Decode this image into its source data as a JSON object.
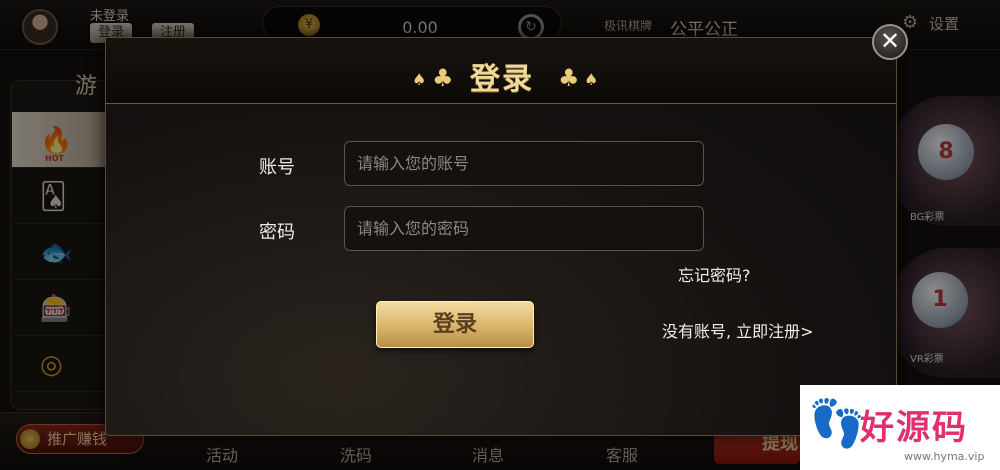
{
  "header": {
    "user_status": "未登录",
    "login_mini": "登录",
    "register_mini": "注册",
    "balance": "0.00",
    "coin_icon": "coin-icon",
    "refresh_icon": "refresh-icon",
    "brand_logo": "极讯棋牌",
    "slogan": "公平公正",
    "settings_label": "设置",
    "settings_icon": "gear-icon"
  },
  "sidebar": {
    "title": "游",
    "items": [
      {
        "icon": "fire-icon",
        "badge": "HOT"
      },
      {
        "icon": "playing-cards-icon"
      },
      {
        "icon": "fish-icon"
      },
      {
        "icon": "slot-machine-icon"
      },
      {
        "icon": "bowl-icon"
      },
      {
        "icon": "soccer-ball-icon"
      }
    ]
  },
  "right_panel": {
    "bg_label": "BG彩票",
    "vr_label": "VR彩票",
    "bg_ball_number": "8",
    "vr_ball_number": "1"
  },
  "bottom_bar": {
    "promote_label": "推广赚钱",
    "tabs": [
      "活动",
      "洗码",
      "消息",
      "客服"
    ],
    "withdraw_label": "提现"
  },
  "modal": {
    "title": "登录",
    "account_label": "账号",
    "account_placeholder": "请输入您的账号",
    "account_value": "",
    "password_label": "密码",
    "password_placeholder": "请输入您的密码",
    "password_value": "",
    "forgot_link": "忘记密码?",
    "login_button": "登录",
    "register_link": "没有账号, 立即注册>",
    "close_icon": "close-icon"
  },
  "watermark": {
    "text": "好源码",
    "url": "www.hyma.vip",
    "icon": "footprint-icon"
  },
  "colors": {
    "accent_gold": "#f0d79a",
    "button_gold": "#d8b46a",
    "withdraw_red": "#d23a2a",
    "watermark_pink": "#df2f6e",
    "watermark_blue": "#17b3d6"
  }
}
